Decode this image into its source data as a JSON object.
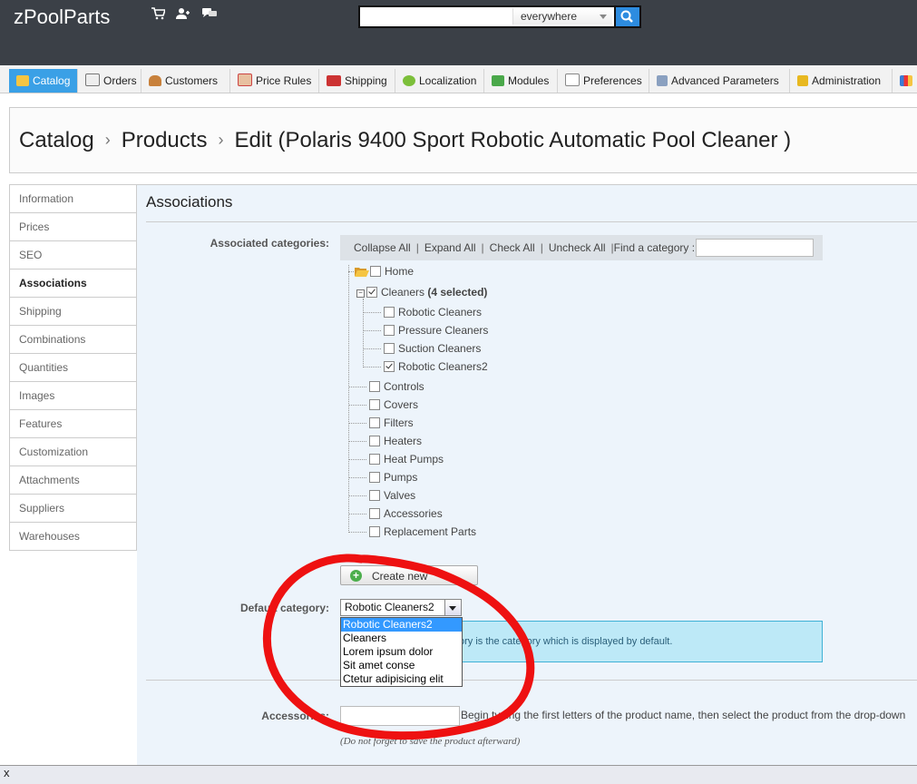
{
  "header": {
    "brand": "zPoolParts",
    "search_value": "",
    "search_scope": "everywhere",
    "icons": [
      "cart-icon",
      "users-icon",
      "messages-icon",
      "search-icon"
    ]
  },
  "tabs": [
    {
      "label": "Catalog",
      "icon": "folder-icon",
      "active": true
    },
    {
      "label": "Orders",
      "icon": "cart-icon"
    },
    {
      "label": "Customers",
      "icon": "user-icon"
    },
    {
      "label": "Price Rules",
      "icon": "price-tag-icon"
    },
    {
      "label": "Shipping",
      "icon": "truck-icon"
    },
    {
      "label": "Localization",
      "icon": "globe-icon"
    },
    {
      "label": "Modules",
      "icon": "puzzle-icon"
    },
    {
      "label": "Preferences",
      "icon": "preferences-icon"
    },
    {
      "label": "Advanced Parameters",
      "icon": "wrench-icon"
    },
    {
      "label": "Administration",
      "icon": "key-icon"
    }
  ],
  "breadcrumb": {
    "items": [
      "Catalog",
      "Products",
      "Edit (Polaris 9400 Sport Robotic Automatic Pool Cleaner )"
    ],
    "separator": "›"
  },
  "leftnav": {
    "items": [
      "Information",
      "Prices",
      "SEO",
      "Associations",
      "Shipping",
      "Combinations",
      "Quantities",
      "Images",
      "Features",
      "Customization",
      "Attachments",
      "Suppliers",
      "Warehouses"
    ],
    "selected": "Associations"
  },
  "panel": {
    "title": "Associations",
    "categories_label": "Associated categories:",
    "toolbar": {
      "collapse_all": "Collapse All",
      "expand_all": "Expand All",
      "check_all": "Check All",
      "uncheck_all": "Uncheck All",
      "find_label": "Find a category :",
      "find_value": ""
    },
    "tree": {
      "home": "Home",
      "cleaners": "Cleaners",
      "cleaners_count": "(4 selected)",
      "children": [
        {
          "label": "Robotic Cleaners",
          "checked": false
        },
        {
          "label": "Pressure Cleaners",
          "checked": false
        },
        {
          "label": "Suction Cleaners",
          "checked": false
        },
        {
          "label": "Robotic Cleaners2",
          "checked": true
        }
      ],
      "others": [
        "Controls",
        "Covers",
        "Filters",
        "Heaters",
        "Heat Pumps",
        "Pumps",
        "Valves",
        "Accessories",
        "Replacement Parts"
      ]
    },
    "create_new": "Create new",
    "default_label": "Default category:",
    "default_value": "Robotic Cleaners2",
    "default_options": [
      "Robotic Cleaners2",
      "Cleaners",
      "Lorem ipsum dolor",
      "Sit amet conse",
      "Ctetur adipisicing elit"
    ],
    "default_info": "ory is the category which is displayed by default.",
    "accessories_label": "Accessories:",
    "accessories_value": "",
    "accessories_help": "Begin typing the first letters of the product name, then select the product from the drop-down",
    "accessories_note": "(Do not forget to save the product afterward)"
  },
  "colors": {
    "header_bg": "#3b4047",
    "active_tab": "#3aa0e6",
    "annotation": "#ee1111",
    "highlight": "#3399ff"
  },
  "bottombar": {
    "close": "x"
  }
}
